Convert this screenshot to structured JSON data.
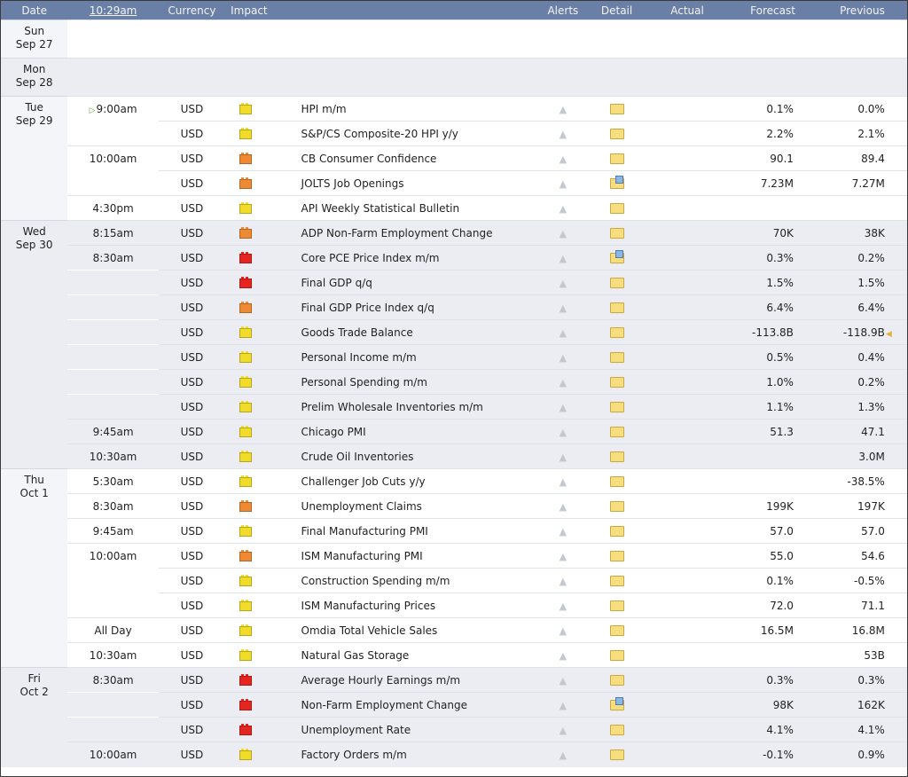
{
  "header": {
    "date": "Date",
    "time": "10:29am",
    "currency": "Currency",
    "impact": "Impact",
    "alerts": "Alerts",
    "detail": "Detail",
    "actual": "Actual",
    "forecast": "Forecast",
    "previous": "Previous"
  },
  "rows": [
    {
      "type": "day",
      "day": "Sun",
      "date": "Sep 27",
      "shade": 0
    },
    {
      "type": "day",
      "day": "Mon",
      "date": "Sep 28",
      "shade": 1
    },
    {
      "day": "Tue",
      "date": "Sep 29",
      "span": 5,
      "time": "9:00am",
      "next": true,
      "cur": "USD",
      "imp": "low",
      "event": "HPI m/m",
      "doc": false,
      "actual": "",
      "forecast": "0.1%",
      "previous": "0.0%",
      "shade": 0
    },
    {
      "cont": true,
      "time": "",
      "cur": "USD",
      "imp": "low",
      "event": "S&P/CS Composite-20 HPI y/y",
      "doc": false,
      "actual": "",
      "forecast": "2.2%",
      "previous": "2.1%",
      "shade": 0
    },
    {
      "time": "10:00am",
      "cur": "USD",
      "imp": "med",
      "event": "CB Consumer Confidence",
      "doc": false,
      "actual": "",
      "forecast": "90.1",
      "previous": "89.4",
      "shade": 0
    },
    {
      "cont": true,
      "time": "",
      "cur": "USD",
      "imp": "med",
      "event": "JOLTS Job Openings",
      "doc": true,
      "actual": "",
      "forecast": "7.23M",
      "previous": "7.27M",
      "shade": 0
    },
    {
      "time": "4:30pm",
      "cur": "USD",
      "imp": "low",
      "event": "API Weekly Statistical Bulletin",
      "doc": false,
      "actual": "",
      "forecast": "",
      "previous": "",
      "shade": 0
    },
    {
      "day": "Wed",
      "date": "Sep 30",
      "span": 10,
      "time": "8:15am",
      "cur": "USD",
      "imp": "med",
      "event": "ADP Non-Farm Employment Change",
      "doc": false,
      "actual": "",
      "forecast": "70K",
      "previous": "38K",
      "shade": 1
    },
    {
      "time": "8:30am",
      "cur": "USD",
      "imp": "high",
      "event": "Core PCE Price Index m/m",
      "doc": true,
      "actual": "",
      "forecast": "0.3%",
      "previous": "0.2%",
      "shade": 1
    },
    {
      "cont": true,
      "time": "",
      "cur": "USD",
      "imp": "high",
      "event": "Final GDP q/q",
      "doc": false,
      "actual": "",
      "forecast": "1.5%",
      "previous": "1.5%",
      "shade": 1
    },
    {
      "cont": true,
      "time": "",
      "cur": "USD",
      "imp": "med",
      "event": "Final GDP Price Index q/q",
      "doc": false,
      "actual": "",
      "forecast": "6.4%",
      "previous": "6.4%",
      "shade": 1
    },
    {
      "cont": true,
      "time": "",
      "cur": "USD",
      "imp": "low",
      "event": "Goods Trade Balance",
      "doc": false,
      "actual": "",
      "forecast": "-113.8B",
      "previous": "-118.9B",
      "revised": true,
      "shade": 1
    },
    {
      "cont": true,
      "time": "",
      "cur": "USD",
      "imp": "low",
      "event": "Personal Income m/m",
      "doc": false,
      "actual": "",
      "forecast": "0.5%",
      "previous": "0.4%",
      "shade": 1
    },
    {
      "cont": true,
      "time": "",
      "cur": "USD",
      "imp": "low",
      "event": "Personal Spending m/m",
      "doc": false,
      "actual": "",
      "forecast": "1.0%",
      "previous": "0.2%",
      "shade": 1
    },
    {
      "cont": true,
      "time": "",
      "cur": "USD",
      "imp": "low",
      "event": "Prelim Wholesale Inventories m/m",
      "doc": false,
      "actual": "",
      "forecast": "1.1%",
      "previous": "1.3%",
      "shade": 1
    },
    {
      "time": "9:45am",
      "cur": "USD",
      "imp": "low",
      "event": "Chicago PMI",
      "doc": false,
      "actual": "",
      "forecast": "51.3",
      "previous": "47.1",
      "shade": 1
    },
    {
      "time": "10:30am",
      "cur": "USD",
      "imp": "low",
      "event": "Crude Oil Inventories",
      "doc": false,
      "actual": "",
      "forecast": "",
      "previous": "3.0M",
      "shade": 1
    },
    {
      "day": "Thu",
      "date": "Oct 1",
      "span": 8,
      "time": "5:30am",
      "cur": "USD",
      "imp": "low",
      "event": "Challenger Job Cuts y/y",
      "doc": false,
      "actual": "",
      "forecast": "",
      "previous": "-38.5%",
      "shade": 0
    },
    {
      "time": "8:30am",
      "cur": "USD",
      "imp": "med",
      "event": "Unemployment Claims",
      "doc": false,
      "actual": "",
      "forecast": "199K",
      "previous": "197K",
      "shade": 0
    },
    {
      "time": "9:45am",
      "cur": "USD",
      "imp": "low",
      "event": "Final Manufacturing PMI",
      "doc": false,
      "actual": "",
      "forecast": "57.0",
      "previous": "57.0",
      "shade": 0
    },
    {
      "time": "10:00am",
      "cur": "USD",
      "imp": "med",
      "event": "ISM Manufacturing PMI",
      "doc": false,
      "actual": "",
      "forecast": "55.0",
      "previous": "54.6",
      "shade": 0
    },
    {
      "cont": true,
      "time": "",
      "cur": "USD",
      "imp": "low",
      "event": "Construction Spending m/m",
      "doc": false,
      "actual": "",
      "forecast": "0.1%",
      "previous": "-0.5%",
      "shade": 0
    },
    {
      "cont": true,
      "time": "",
      "cur": "USD",
      "imp": "low",
      "event": "ISM Manufacturing Prices",
      "doc": false,
      "actual": "",
      "forecast": "72.0",
      "previous": "71.1",
      "shade": 0
    },
    {
      "time": "All Day",
      "cur": "USD",
      "imp": "low",
      "event": "Omdia Total Vehicle Sales",
      "doc": false,
      "actual": "",
      "forecast": "16.5M",
      "previous": "16.8M",
      "shade": 0
    },
    {
      "time": "10:30am",
      "cur": "USD",
      "imp": "low",
      "event": "Natural Gas Storage",
      "doc": false,
      "actual": "",
      "forecast": "",
      "previous": "53B",
      "shade": 0
    },
    {
      "day": "Fri",
      "date": "Oct 2",
      "span": 4,
      "time": "8:30am",
      "cur": "USD",
      "imp": "high",
      "event": "Average Hourly Earnings m/m",
      "doc": false,
      "actual": "",
      "forecast": "0.3%",
      "previous": "0.3%",
      "shade": 1
    },
    {
      "cont": true,
      "time": "",
      "cur": "USD",
      "imp": "high",
      "event": "Non-Farm Employment Change",
      "doc": true,
      "actual": "",
      "forecast": "98K",
      "previous": "162K",
      "shade": 1
    },
    {
      "cont": true,
      "time": "",
      "cur": "USD",
      "imp": "high",
      "event": "Unemployment Rate",
      "doc": false,
      "actual": "",
      "forecast": "4.1%",
      "previous": "4.1%",
      "shade": 1
    },
    {
      "time": "10:00am",
      "cur": "USD",
      "imp": "low",
      "event": "Factory Orders m/m",
      "doc": false,
      "actual": "",
      "forecast": "-0.1%",
      "previous": "0.9%",
      "shade": 1
    }
  ],
  "icons": {
    "alert": "bell-icon",
    "detail": "folder-icon",
    "impact": "impact-folder-icon",
    "next": "play-arrow-icon",
    "revised": "speaker-icon"
  },
  "colors": {
    "header_bg": "#6a7fa6",
    "impact_low": "#f2dc2a",
    "impact_med": "#ee8a34",
    "impact_high": "#e42520",
    "row_gray": "#ebedf2"
  }
}
